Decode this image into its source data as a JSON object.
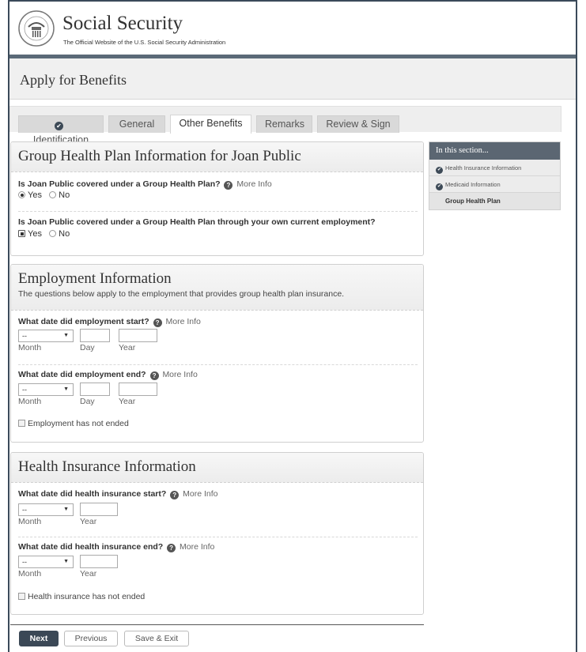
{
  "header": {
    "title": "Social Security",
    "subtitle": "The Official Website of the U.S. Social Security Administration"
  },
  "page_title": "Apply for Benefits",
  "tabs": [
    {
      "label": "Identification",
      "completed": true
    },
    {
      "label": "General",
      "completed": false
    },
    {
      "label": "Other Benefits",
      "completed": false,
      "active": true
    },
    {
      "label": "Remarks",
      "completed": false
    },
    {
      "label": "Review & Sign",
      "completed": false
    }
  ],
  "group_health": {
    "title": "Group Health Plan Information for Joan Public",
    "q1": "Is Joan Public covered under a Group Health Plan?",
    "q1_more": "More Info",
    "q1_answer": "Yes",
    "q2": "Is Joan Public covered under a Group Health Plan through your own current employment?",
    "q2_answer": "Yes",
    "yes": "Yes",
    "no": "No"
  },
  "employment": {
    "title": "Employment Information",
    "subtitle": "The questions below apply to the employment that provides group health plan insurance.",
    "start_q": "What date did employment start?",
    "end_q": "What date did employment end?",
    "more": "More Info",
    "month_value": "--",
    "month_label": "Month",
    "day_label": "Day",
    "year_label": "Year",
    "not_ended": "Employment has not ended"
  },
  "insurance": {
    "title": "Health Insurance Information",
    "start_q": "What date did health insurance start?",
    "end_q": "What date did health insurance end?",
    "more": "More Info",
    "month_value": "--",
    "month_label": "Month",
    "year_label": "Year",
    "not_ended": "Health insurance has not ended"
  },
  "sidebar": {
    "title": "In this section...",
    "items": [
      {
        "label": "Health Insurance Information",
        "completed": true
      },
      {
        "label": "Medicaid Information",
        "completed": true
      },
      {
        "label": "Group Health Plan",
        "current": true
      }
    ]
  },
  "footer": {
    "next": "Next",
    "previous": "Previous",
    "save_exit": "Save & Exit"
  }
}
